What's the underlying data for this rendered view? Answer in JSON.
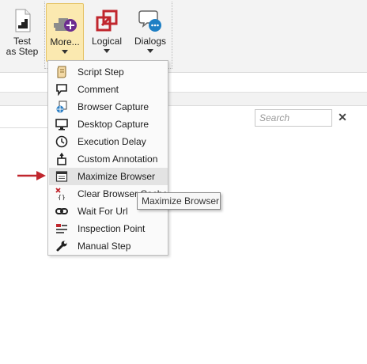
{
  "ribbon": {
    "buttons": [
      {
        "label_line1": "Test",
        "label_line2": "as Step",
        "icon": "test-as-step-icon"
      },
      {
        "label": "More...",
        "icon": "more-add-icon"
      },
      {
        "label": "Logical",
        "icon": "logical-icon"
      },
      {
        "label": "Dialogs",
        "icon": "dialogs-icon"
      }
    ]
  },
  "menu": {
    "items": [
      {
        "label": "Script Step",
        "icon": "script-step-icon"
      },
      {
        "label": "Comment",
        "icon": "comment-icon"
      },
      {
        "label": "Browser Capture",
        "icon": "browser-capture-icon"
      },
      {
        "label": "Desktop Capture",
        "icon": "desktop-capture-icon"
      },
      {
        "label": "Execution Delay",
        "icon": "clock-icon"
      },
      {
        "label": "Custom Annotation",
        "icon": "custom-annotation-icon"
      },
      {
        "label": "Maximize Browser",
        "icon": "maximize-browser-icon"
      },
      {
        "label": "Clear Browser Cache",
        "icon": "clear-browser-cache-icon"
      },
      {
        "label": "Wait For Url",
        "icon": "link-icon"
      },
      {
        "label": "Inspection Point",
        "icon": "inspection-point-icon"
      },
      {
        "label": "Manual Step",
        "icon": "wrench-icon"
      }
    ]
  },
  "tooltip": {
    "text": "Maximize Browser"
  },
  "search": {
    "placeholder": "Search",
    "close": "✕"
  },
  "colors": {
    "accent_red": "#c0262d",
    "hover_bg": "#fbe9b0",
    "dialog_blue": "#1e7fc4",
    "purple": "#6b2c8f"
  }
}
